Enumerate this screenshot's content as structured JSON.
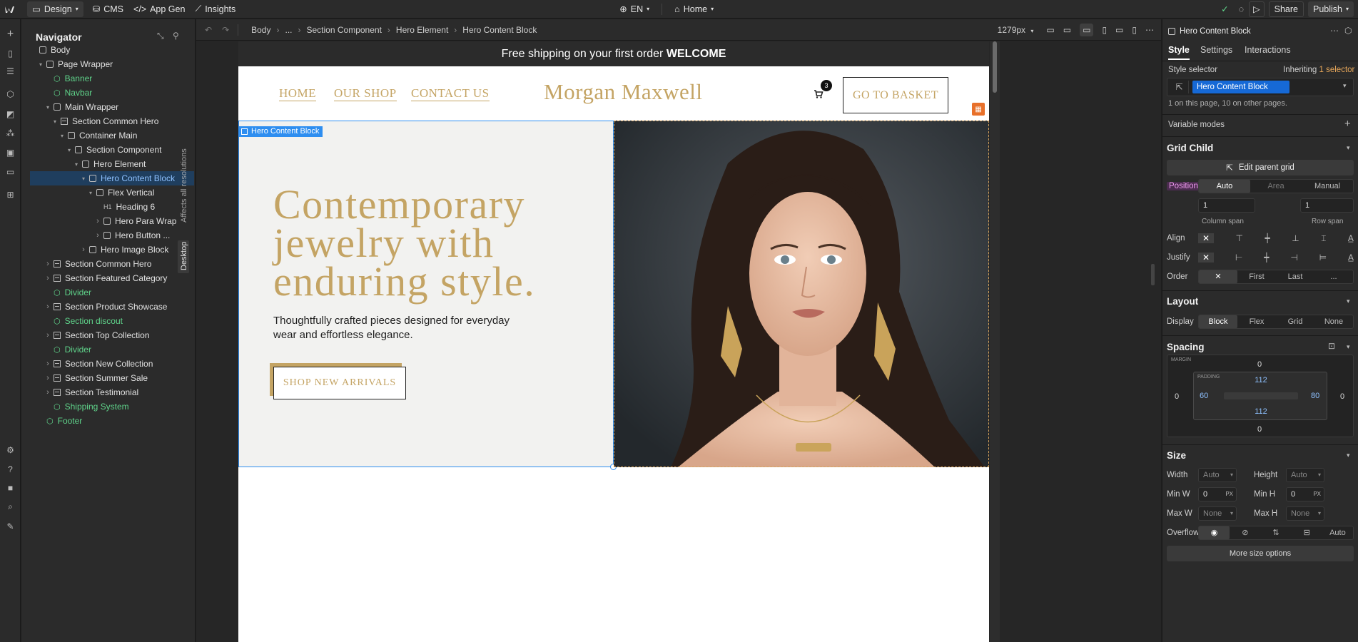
{
  "topbar": {
    "mode_label": "Design",
    "cms_label": "CMS",
    "appgen_label": "App Gen",
    "insights_label": "Insights",
    "locale_label": "EN",
    "page_label": "Home",
    "share_label": "Share",
    "publish_label": "Publish"
  },
  "navigator": {
    "title": "Navigator",
    "items": [
      {
        "label": "Body"
      },
      {
        "label": "Page Wrapper"
      },
      {
        "label": "Banner"
      },
      {
        "label": "Navbar"
      },
      {
        "label": "Main Wrapper"
      },
      {
        "label": "Section Common Hero"
      },
      {
        "label": "Container Main"
      },
      {
        "label": "Section Component"
      },
      {
        "label": "Hero Element"
      },
      {
        "label": "Hero Content Block"
      },
      {
        "label": "Flex Vertical"
      },
      {
        "label": "Heading 6",
        "tag": "H1"
      },
      {
        "label": "Hero Para Wrap"
      },
      {
        "label": "Hero Button ..."
      },
      {
        "label": "Hero Image Block"
      },
      {
        "label": "Section Common Hero"
      },
      {
        "label": "Section Featured Category"
      },
      {
        "label": "Divider"
      },
      {
        "label": "Section Product Showcase"
      },
      {
        "label": "Section discout"
      },
      {
        "label": "Section Top Collection"
      },
      {
        "label": "Divider"
      },
      {
        "label": "Section New Collection"
      },
      {
        "label": "Section Summer Sale"
      },
      {
        "label": "Section Testimonial"
      },
      {
        "label": "Shipping System"
      },
      {
        "label": "Footer"
      }
    ]
  },
  "breadcrumb": {
    "items": [
      "Body",
      "...",
      "Section Component",
      "Hero Element",
      "Hero Content Block"
    ],
    "width_label": "1279px"
  },
  "canvas_side": {
    "affects_label": "Affects all resolutions",
    "desktop_label": "Desktop"
  },
  "site": {
    "banner_text": "Free shipping on your first order ",
    "banner_code": "WELCOME",
    "nav_links": [
      "HOME",
      "OUR SHOP",
      "CONTACT US"
    ],
    "brand": "Morgan Maxwell",
    "cart_count": "3",
    "basket_button": "GO TO BASKET",
    "selection_label": "Hero Content Block",
    "hero_heading": [
      "Contemporary",
      "jewelry with",
      "enduring style."
    ],
    "hero_para_1": "Thoughtfully crafted pieces designed for everyday",
    "hero_para_2": "wear and effortless elegance.",
    "hero_button": "SHOP NEW ARRIVALS",
    "colors": {
      "gold": "#c4a464",
      "hero_bg": "#f2f2f0",
      "banner_bg": "#2b2b2b",
      "selection": "#2e8ef0"
    }
  },
  "panel": {
    "element_name": "Hero Content Block",
    "tabs": [
      "Style",
      "Settings",
      "Interactions"
    ],
    "style_selector_label": "Style selector",
    "inheriting_label": "Inheriting ",
    "inheriting_count": "1 selector",
    "selector_chip": "Hero Content Block",
    "usage_note": "1 on this page, 10 on other pages.",
    "variable_modes": "Variable modes",
    "grid_child": {
      "title": "Grid Child",
      "edit_parent": "Edit parent grid",
      "position_label": "Position",
      "position_options": [
        "Auto",
        "Area",
        "Manual"
      ],
      "column_span_value": "1",
      "row_span_value": "1",
      "column_span_label": "Column span",
      "row_span_label": "Row span",
      "align_label": "Align",
      "justify_label": "Justify",
      "order_label": "Order",
      "order_options": [
        "First",
        "Last",
        "..."
      ]
    },
    "layout": {
      "title": "Layout",
      "display_label": "Display",
      "display_options": [
        "Block",
        "Flex",
        "Grid",
        "None"
      ]
    },
    "spacing": {
      "title": "Spacing",
      "margin_label": "MARGIN",
      "padding_label": "PADDING",
      "margin_top": "0",
      "margin_bottom": "0",
      "margin_left": "0",
      "margin_right": "0",
      "padding_top": "112",
      "padding_bottom": "112",
      "padding_left": "60",
      "padding_right": "80"
    },
    "size": {
      "title": "Size",
      "width_label": "Width",
      "width_value": "Auto",
      "height_label": "Height",
      "height_value": "Auto",
      "minw_label": "Min W",
      "minw_value": "0",
      "minh_label": "Min H",
      "minh_value": "0",
      "px_unit": "PX",
      "maxw_label": "Max W",
      "maxw_value": "None",
      "maxh_label": "Max H",
      "maxh_value": "None",
      "overflow_label": "Overflow",
      "overflow_auto": "Auto",
      "more_label": "More size options"
    }
  }
}
